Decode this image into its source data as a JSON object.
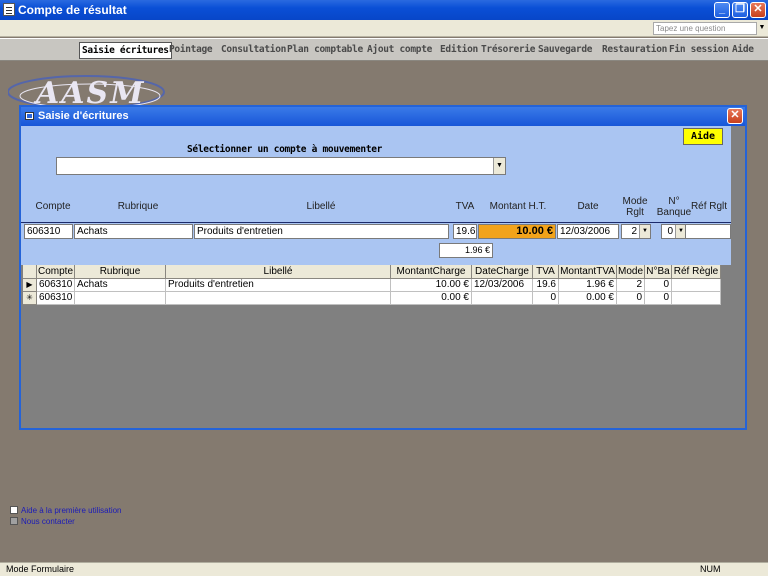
{
  "window": {
    "title": "Compte de résultat"
  },
  "helpbar": {
    "search_placeholder": "Tapez une question"
  },
  "menu": [
    "Saisie écritures",
    "Pointage",
    "Consultation",
    "Plan comptable",
    "Ajout compte",
    "Edition",
    "Trésorerie",
    "Sauvegarde",
    "Restauration",
    "Fin session",
    "Aide"
  ],
  "logo": {
    "text": "AASM"
  },
  "form": {
    "title": "Saisie d'écritures",
    "aide_label": "Aide",
    "select_label": "Sélectionner un compte à mouvementer",
    "select_value": "",
    "labels": {
      "compte": "Compte",
      "rubrique": "Rubrique",
      "libelle": "Libellé",
      "tva": "TVA",
      "montant": "Montant H.T.",
      "date": "Date",
      "mode_rglt": "Mode\nRglt",
      "n_banque": "N°\nBanque",
      "ref_rglt": "Réf Rglt"
    },
    "entry": {
      "compte": "606310",
      "rubrique": "Achats",
      "libelle": "Produits d'entretien",
      "tva": "19.6",
      "montant": "10.00 €",
      "date": "12/03/2006",
      "mode_rglt": "2",
      "n_banque": "0",
      "ref_rglt": "",
      "tva_amount": "1.96 €"
    }
  },
  "grid": {
    "headers": [
      "Compte",
      "Rubrique",
      "Libellé",
      "MontantCharge",
      "DateCharge",
      "TVA",
      "MontantTVA",
      "Mode",
      "N°Ba",
      "Réf Règle"
    ],
    "rows": [
      {
        "marker": "▶",
        "compte": "606310",
        "rubrique": "Achats",
        "libelle": "Produits d'entretien",
        "montant": "10.00 €",
        "date": "12/03/2006",
        "tva": "19.6",
        "montant_tva": "1.96 €",
        "mode": "2",
        "nba": "0",
        "ref": ""
      },
      {
        "marker": "✳",
        "compte": "606310",
        "rubrique": "",
        "libelle": "",
        "montant": "0.00 €",
        "date": "",
        "tva": "0",
        "montant_tva": "0.00 €",
        "mode": "0",
        "nba": "0",
        "ref": ""
      }
    ]
  },
  "links": {
    "first_use": "Aide à la première utilisation",
    "contact": "Nous contacter"
  },
  "status": {
    "mode": "Mode Formulaire",
    "num": "NUM"
  }
}
